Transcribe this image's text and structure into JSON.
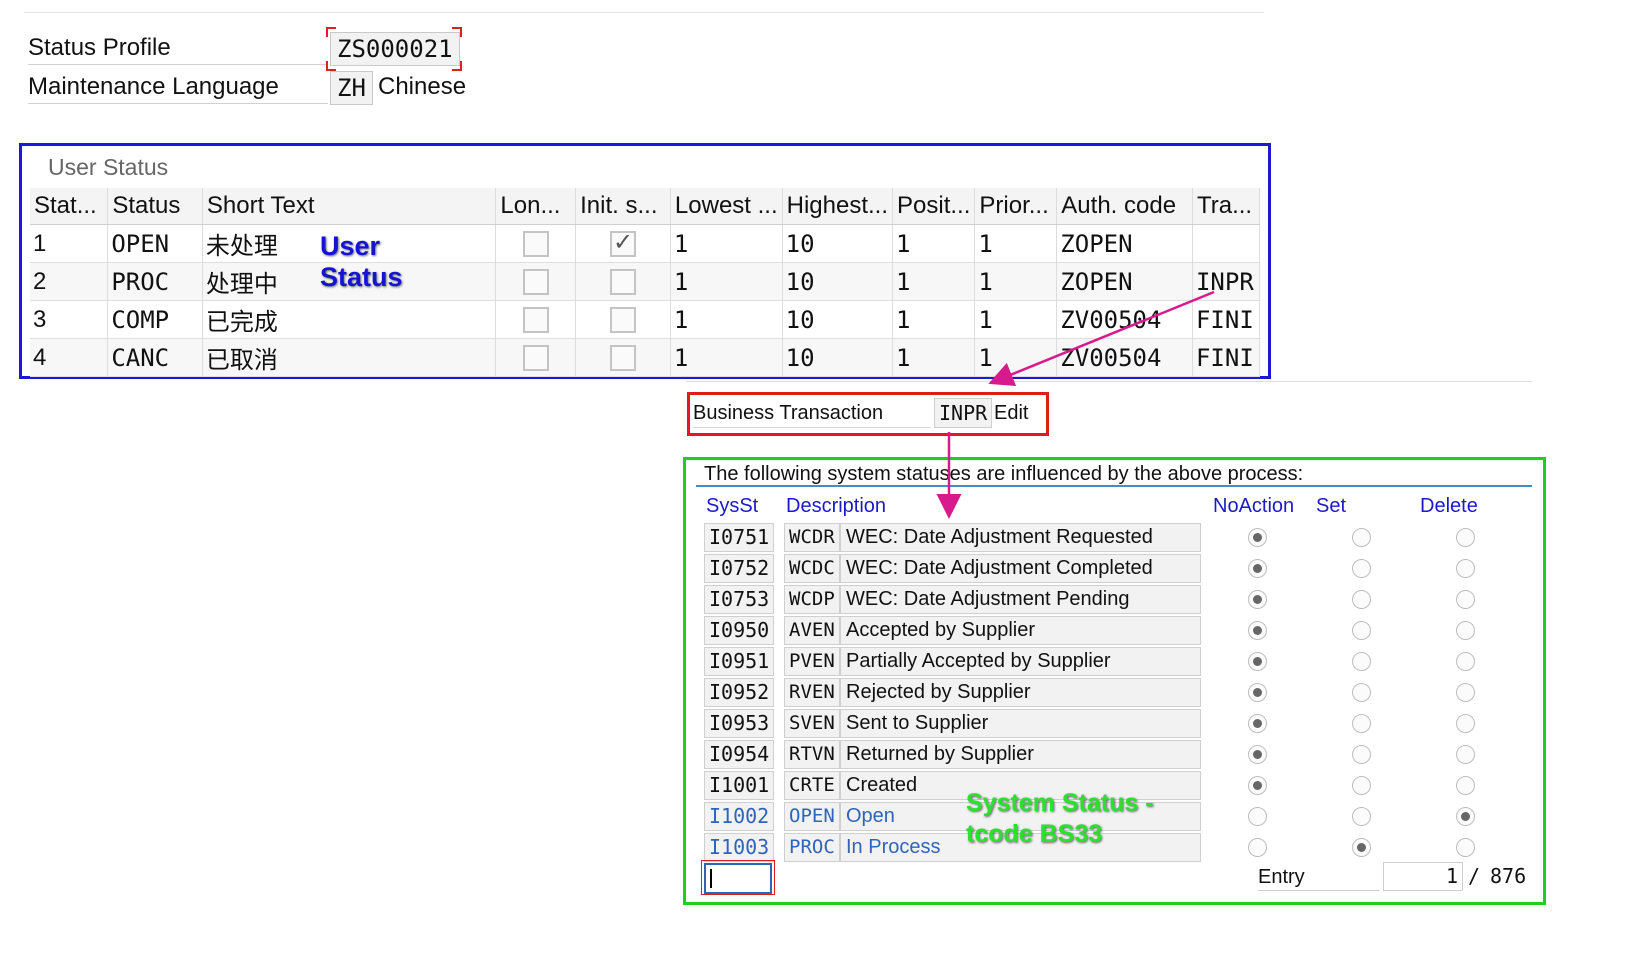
{
  "header": {
    "status_profile_label": "Status Profile",
    "status_profile_value": "ZS000021",
    "maintenance_language_label": "Maintenance Language",
    "maintenance_language_code": "ZH",
    "maintenance_language_name": "Chinese"
  },
  "user_status": {
    "title": "User Status",
    "columns": [
      "Stat...",
      "Status",
      "Short Text",
      "Lon...",
      "Init. s...",
      "Lowest ...",
      "Highest...",
      "Posit...",
      "Prior...",
      "Auth. code",
      "Tra..."
    ],
    "rows": [
      {
        "num": "1",
        "status": "OPEN",
        "short_text": "未处理",
        "long": false,
        "init": true,
        "lowest": "1",
        "highest": "10",
        "position": "1",
        "priority": "1",
        "auth": "ZOPEN",
        "trans": ""
      },
      {
        "num": "2",
        "status": "PROC",
        "short_text": "处理中",
        "long": false,
        "init": false,
        "lowest": "1",
        "highest": "10",
        "position": "1",
        "priority": "1",
        "auth": "ZOPEN",
        "trans": "INPR"
      },
      {
        "num": "3",
        "status": "COMP",
        "short_text": "已完成",
        "long": false,
        "init": false,
        "lowest": "1",
        "highest": "10",
        "position": "1",
        "priority": "1",
        "auth": "ZV00504",
        "trans": "FINI"
      },
      {
        "num": "4",
        "status": "CANC",
        "short_text": "已取消",
        "long": false,
        "init": false,
        "lowest": "1",
        "highest": "10",
        "position": "1",
        "priority": "1",
        "auth": "ZV00504",
        "trans": "FINI"
      }
    ],
    "annotation_line1": "User",
    "annotation_line2": "Status"
  },
  "business_transaction": {
    "label": "Business Transaction",
    "code": "INPR",
    "text": "Edit"
  },
  "system_status": {
    "intro": "The following system statuses are influenced by the above process:",
    "headers": {
      "sysst": "SysSt",
      "description": "Description",
      "noaction": "NoAction",
      "set": "Set",
      "delete": "Delete"
    },
    "rows": [
      {
        "id": "I0751",
        "code": "WCDR",
        "desc": "WEC: Date Adjustment Requested",
        "selected": "noaction",
        "highlight": false
      },
      {
        "id": "I0752",
        "code": "WCDC",
        "desc": "WEC: Date Adjustment Completed",
        "selected": "noaction",
        "highlight": false
      },
      {
        "id": "I0753",
        "code": "WCDP",
        "desc": "WEC: Date Adjustment Pending",
        "selected": "noaction",
        "highlight": false
      },
      {
        "id": "I0950",
        "code": "AVEN",
        "desc": "Accepted by Supplier",
        "selected": "noaction",
        "highlight": false
      },
      {
        "id": "I0951",
        "code": "PVEN",
        "desc": "Partially Accepted by Supplier",
        "selected": "noaction",
        "highlight": false
      },
      {
        "id": "I0952",
        "code": "RVEN",
        "desc": "Rejected by Supplier",
        "selected": "noaction",
        "highlight": false
      },
      {
        "id": "I0953",
        "code": "SVEN",
        "desc": "Sent to Supplier",
        "selected": "noaction",
        "highlight": false
      },
      {
        "id": "I0954",
        "code": "RTVN",
        "desc": "Returned by Supplier",
        "selected": "noaction",
        "highlight": false
      },
      {
        "id": "I1001",
        "code": "CRTE",
        "desc": "Created",
        "selected": "noaction",
        "highlight": false
      },
      {
        "id": "I1002",
        "code": "OPEN",
        "desc": "Open",
        "selected": "delete",
        "highlight": true
      },
      {
        "id": "I1003",
        "code": "PROC",
        "desc": "In Process",
        "selected": "set",
        "highlight": true
      }
    ],
    "annotation_line1": "System Status -",
    "annotation_line2": "tcode BS33",
    "entry_label": "Entry",
    "entry_value": "1",
    "entry_separator": "/",
    "entry_total": "876"
  },
  "colors": {
    "user_status_frame": "#1a1ad6",
    "business_transaction_frame": "#e01b1b",
    "system_status_frame": "#1fcf1f",
    "arrow": "#d81b8c"
  }
}
